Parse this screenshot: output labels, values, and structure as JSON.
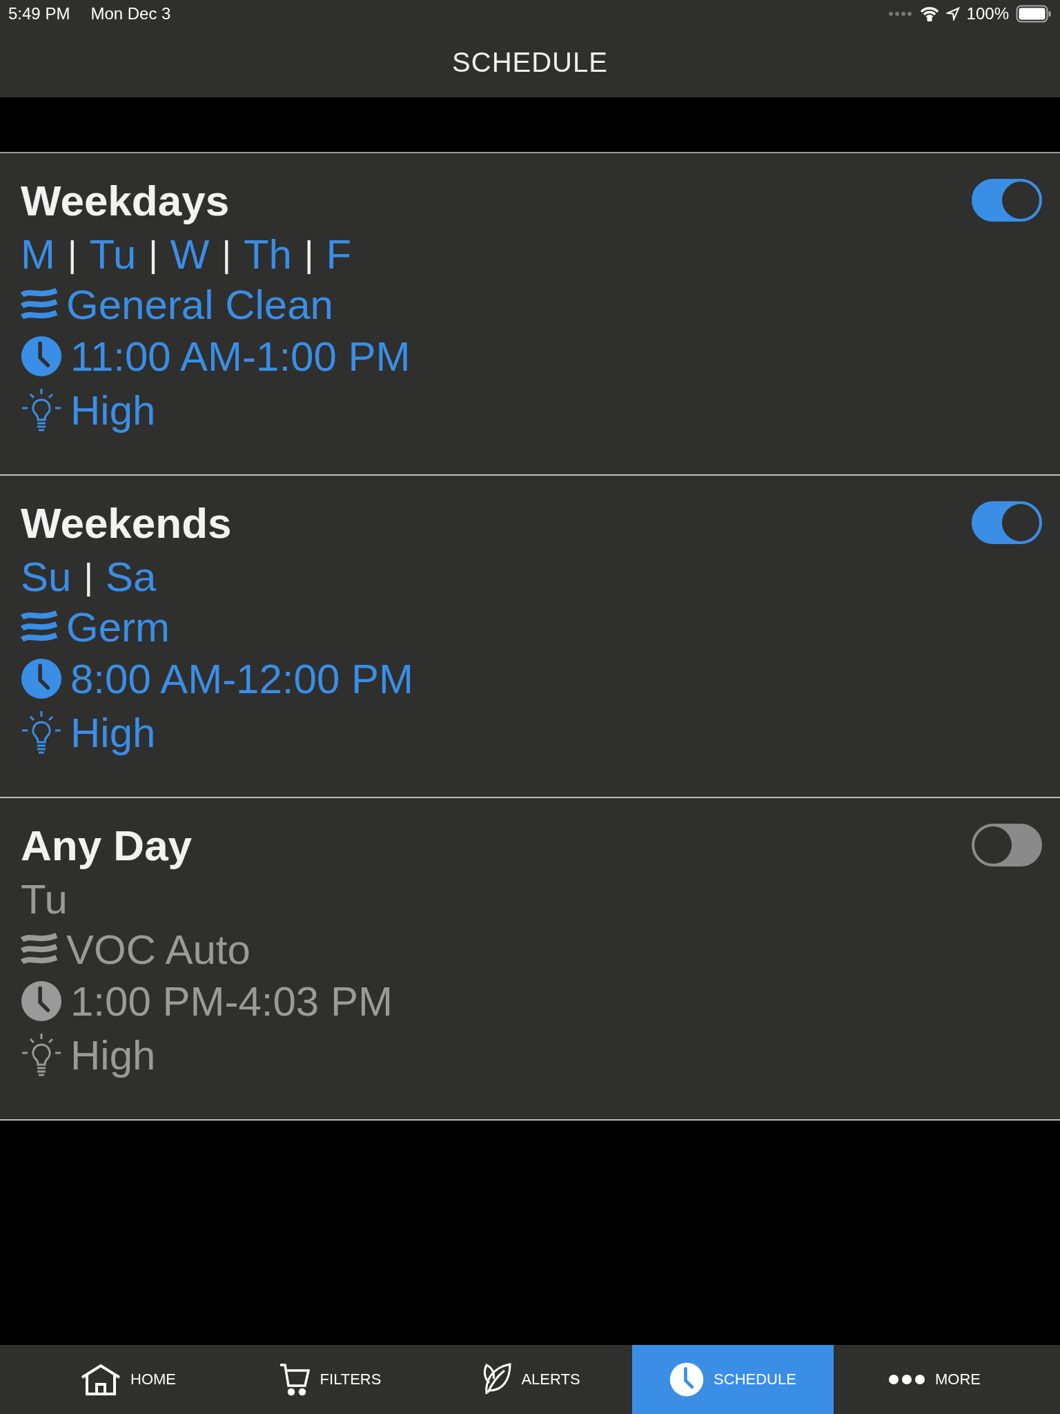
{
  "status_bar": {
    "time": "5:49 PM",
    "date": "Mon Dec 3",
    "battery": "100%"
  },
  "header": {
    "title": "SCHEDULE"
  },
  "schedules": [
    {
      "name": "Weekdays",
      "on": true,
      "days": [
        "M",
        "Tu",
        "W",
        "Th",
        "F"
      ],
      "separator": "|",
      "mode": "General Clean",
      "time": "11:00 AM-1:00 PM",
      "intensity": "High"
    },
    {
      "name": "Weekends",
      "on": true,
      "days": [
        "Su",
        "Sa"
      ],
      "separator": "|",
      "mode": "Germ",
      "time": "8:00 AM-12:00 PM",
      "intensity": "High"
    },
    {
      "name": "Any Day",
      "on": false,
      "days": [
        "Tu"
      ],
      "mode": "VOC Auto",
      "time": "1:00 PM-4:03 PM",
      "intensity": "High"
    }
  ],
  "tab_bar": [
    {
      "kind": "home",
      "label": "HOME",
      "selected": false
    },
    {
      "kind": "cart",
      "label": "FILTERS",
      "selected": false
    },
    {
      "kind": "leaf",
      "label": "ALERTS",
      "selected": false
    },
    {
      "kind": "clock",
      "label": "SCHEDULE",
      "selected": true
    },
    {
      "kind": "dots",
      "label": "MORE",
      "selected": false
    }
  ]
}
